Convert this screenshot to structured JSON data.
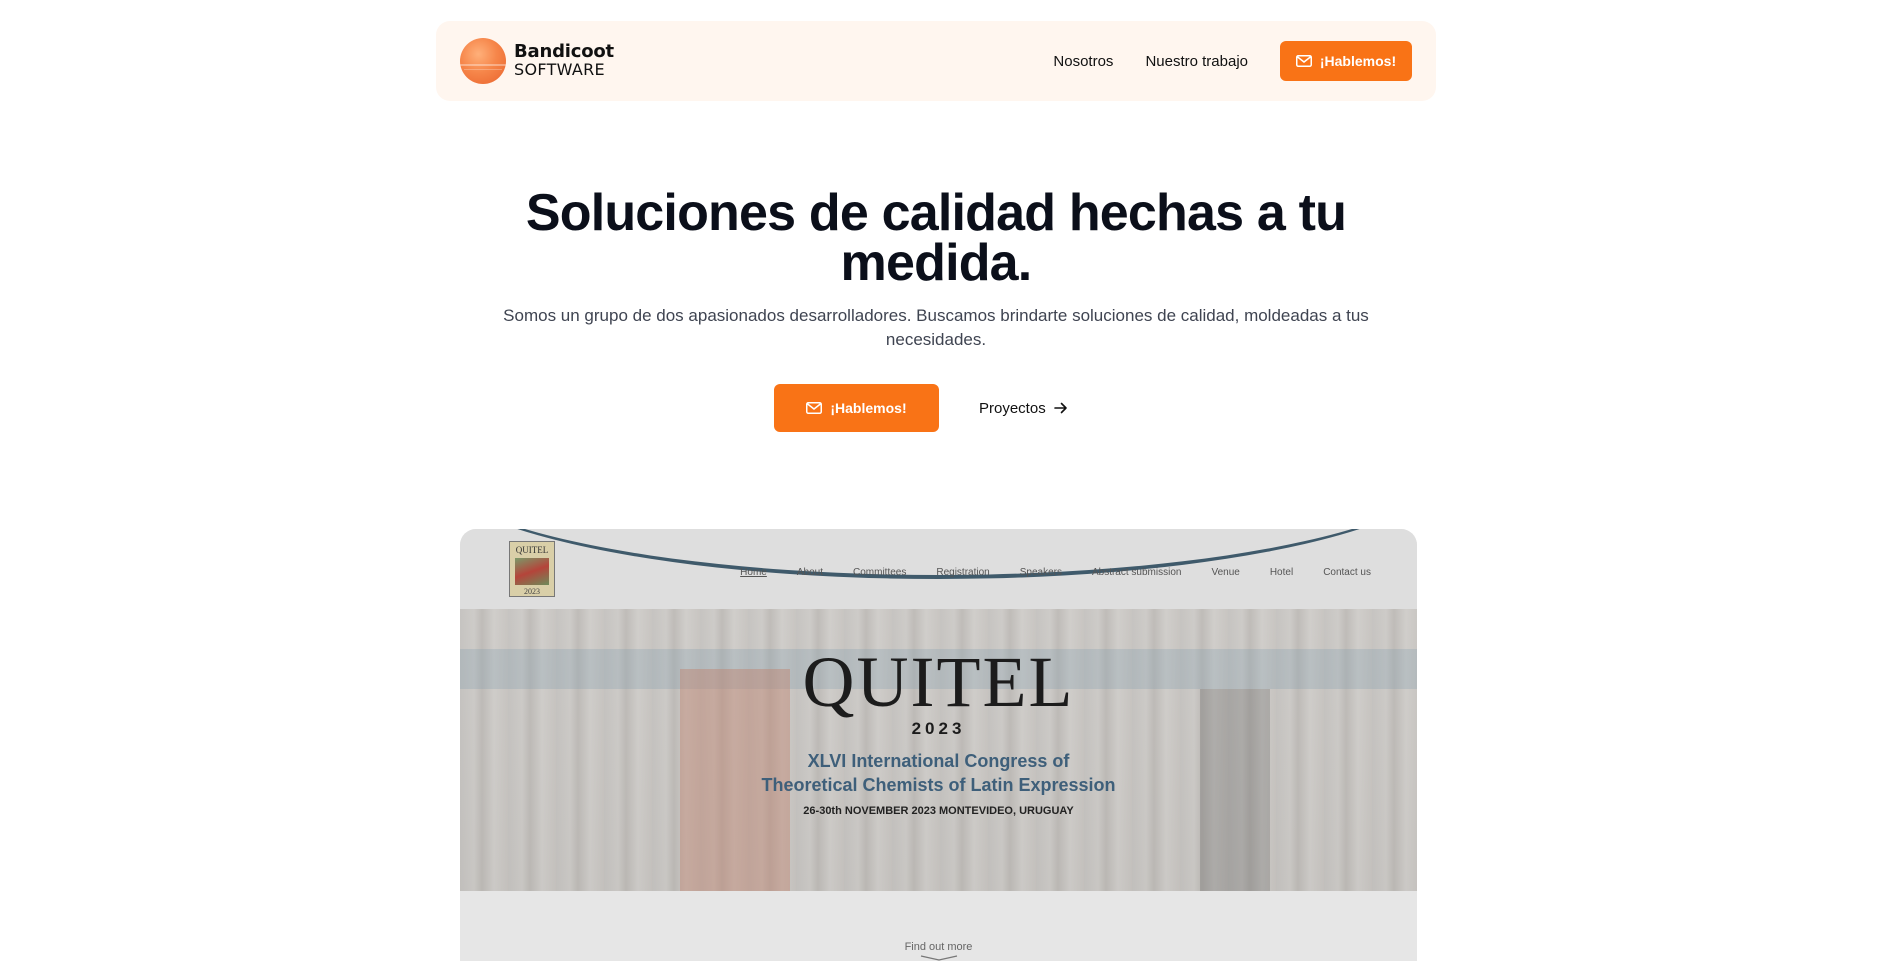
{
  "navbar": {
    "brand_name": "Bandicoot",
    "brand_sub": "SOFTWARE",
    "links": [
      "Nosotros",
      "Nuestro trabajo"
    ],
    "cta_label": "¡Hablemos!"
  },
  "hero": {
    "title": "Soluciones de calidad hechas a tu medida.",
    "description": "Somos un grupo de dos apasionados desarrolladores. Buscamos brindarte soluciones de calidad, moldeadas a tus necesidades.",
    "cta_label": "¡Hablemos!",
    "projects_label": "Proyectos"
  },
  "showcase": {
    "logo_word": "QUITEL",
    "logo_year": "2023",
    "nav": [
      "Home",
      "About",
      "Committees",
      "Registration",
      "Speakers",
      "Abstract submission",
      "Venue",
      "Hotel",
      "Contact us"
    ],
    "title": "QUITEL",
    "year": "2023",
    "subtitle_line1": "XLVI International Congress of",
    "subtitle_line2": "Theoretical Chemists of Latin Expression",
    "date": "26-30th NOVEMBER 2023 MONTEVIDEO, URUGUAY",
    "find_more": "Find out more"
  },
  "colors": {
    "accent": "#f97316",
    "navbar_bg": "#fff6ef",
    "heading": "#0b0f1a",
    "body_text": "#3f4451"
  },
  "icons": {
    "mail": "mail-icon",
    "arrow_right": "arrow-right-icon",
    "chevron_down": "chevron-down-icon"
  }
}
